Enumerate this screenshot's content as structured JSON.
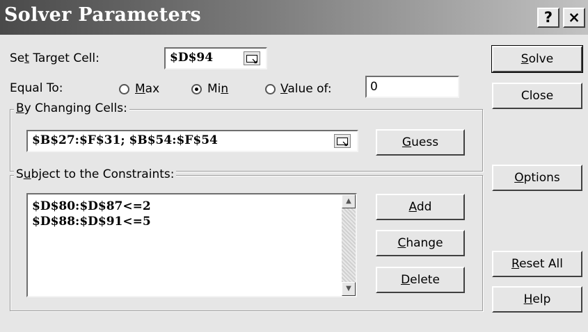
{
  "window": {
    "title": "Solver Parameters",
    "help_label": "?",
    "close_label": "×"
  },
  "target": {
    "label_pre": "Se",
    "label_ul": "t",
    "label_post": " Target Cell:",
    "value": "$D$94"
  },
  "equal_to": {
    "label": "Equal To:",
    "max": {
      "pre": "",
      "ul": "M",
      "post": "ax",
      "selected": false
    },
    "min": {
      "pre": "Mi",
      "ul": "n",
      "post": "",
      "selected": true
    },
    "value_of": {
      "pre": "",
      "ul": "V",
      "post": "alue of:",
      "selected": false
    },
    "value_input": "0"
  },
  "changing": {
    "label_ul": "B",
    "label_post": "y Changing Cells:",
    "value": "$B$27:$F$31; $B$54:$F$54",
    "guess": {
      "ul": "G",
      "post": "uess"
    }
  },
  "constraints": {
    "label_pre": "S",
    "label_ul": "u",
    "label_post": "bject to the Constraints:",
    "items": [
      "$D$80:$D$87<=2",
      "$D$88:$D$91<=5"
    ],
    "add": {
      "ul": "A",
      "post": "dd"
    },
    "change": {
      "ul": "C",
      "post": "hange"
    },
    "delete": {
      "ul": "D",
      "post": "elete"
    }
  },
  "side_buttons": {
    "solve": {
      "ul": "S",
      "post": "olve"
    },
    "close": "Close",
    "options": {
      "ul": "O",
      "post": "ptions"
    },
    "reset": {
      "ul": "R",
      "post": "eset All"
    },
    "help": {
      "ul": "H",
      "post": "elp"
    }
  },
  "icons": {
    "collapse": "collapse-dialog-icon",
    "scroll_up": "scroll-up-arrow-icon",
    "scroll_down": "scroll-down-arrow-icon"
  },
  "colors": {
    "titlebar_dark": "#4a4a4a",
    "titlebar_light": "#c2c2c2",
    "dialog_face": "#e6e6e6"
  }
}
